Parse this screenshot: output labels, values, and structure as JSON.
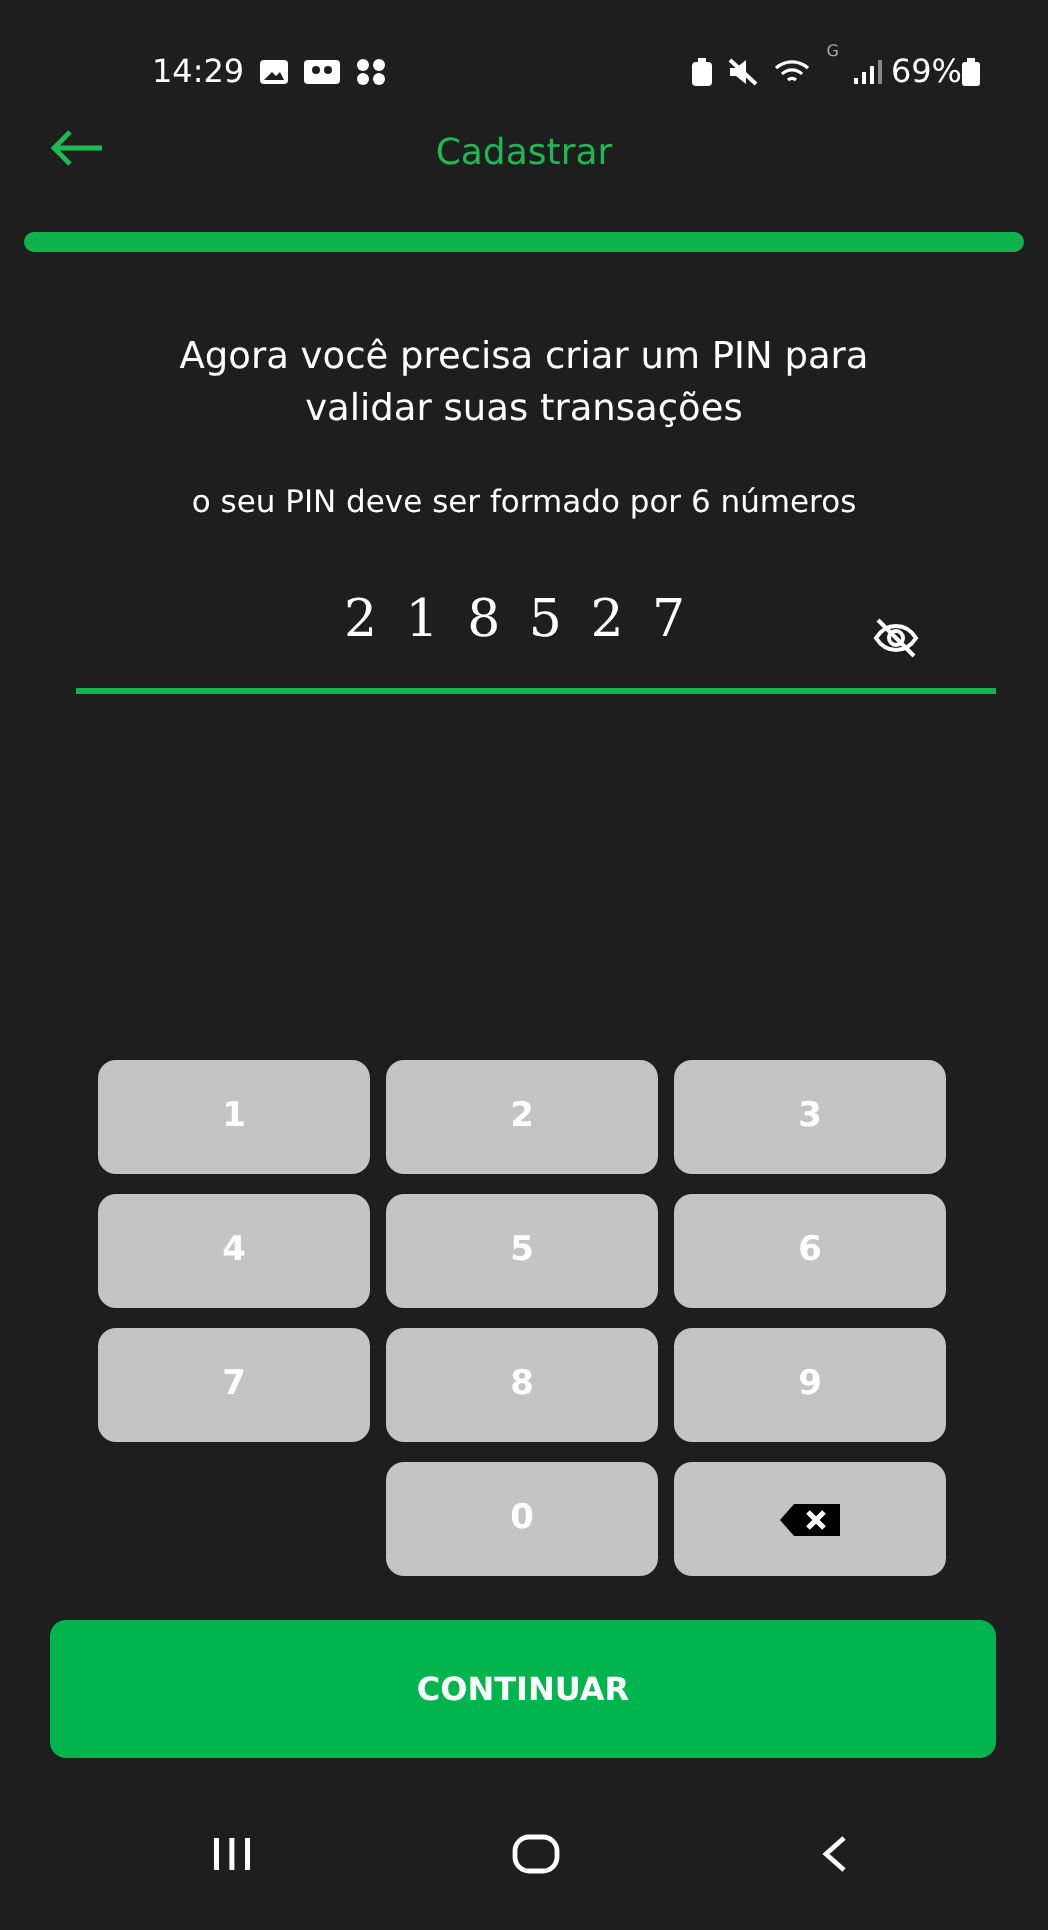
{
  "status_bar": {
    "time": "14:29",
    "network": "G",
    "battery": "69%"
  },
  "header": {
    "title": "Cadastrar"
  },
  "progress": {
    "level": 1.0
  },
  "heading": "Agora você precisa criar um PIN para validar suas transações",
  "hint": "o seu PIN deve ser formado por 6 números",
  "pin_field": {
    "value": "2 1 8 5 2 7"
  },
  "keypad": [
    {
      "kind": "digit",
      "label": "1"
    },
    {
      "kind": "digit",
      "label": "2"
    },
    {
      "kind": "digit",
      "label": "3"
    },
    {
      "kind": "digit",
      "label": "4"
    },
    {
      "kind": "digit",
      "label": "5"
    },
    {
      "kind": "digit",
      "label": "6"
    },
    {
      "kind": "digit",
      "label": "7"
    },
    {
      "kind": "digit",
      "label": "8"
    },
    {
      "kind": "digit",
      "label": "9"
    },
    {
      "kind": "empty"
    },
    {
      "kind": "digit",
      "label": "0"
    },
    {
      "kind": "backspace"
    }
  ],
  "continue_button": "CONTINUAR"
}
